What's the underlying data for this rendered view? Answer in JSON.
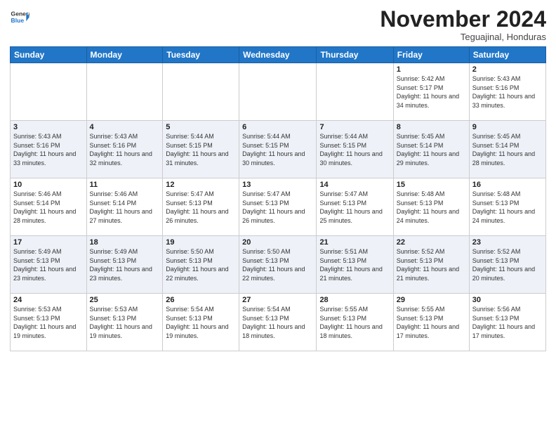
{
  "logo": {
    "line1": "General",
    "line2": "Blue"
  },
  "title": "November 2024",
  "subtitle": "Teguajinal, Honduras",
  "weekdays": [
    "Sunday",
    "Monday",
    "Tuesday",
    "Wednesday",
    "Thursday",
    "Friday",
    "Saturday"
  ],
  "weeks": [
    [
      {
        "num": "",
        "empty": true
      },
      {
        "num": "",
        "empty": true
      },
      {
        "num": "",
        "empty": true
      },
      {
        "num": "",
        "empty": true
      },
      {
        "num": "",
        "empty": true
      },
      {
        "num": "1",
        "sunrise": "5:42 AM",
        "sunset": "5:17 PM",
        "daylight": "11 hours and 34 minutes."
      },
      {
        "num": "2",
        "sunrise": "5:43 AM",
        "sunset": "5:16 PM",
        "daylight": "11 hours and 33 minutes."
      }
    ],
    [
      {
        "num": "3",
        "sunrise": "5:43 AM",
        "sunset": "5:16 PM",
        "daylight": "11 hours and 33 minutes."
      },
      {
        "num": "4",
        "sunrise": "5:43 AM",
        "sunset": "5:16 PM",
        "daylight": "11 hours and 32 minutes."
      },
      {
        "num": "5",
        "sunrise": "5:44 AM",
        "sunset": "5:15 PM",
        "daylight": "11 hours and 31 minutes."
      },
      {
        "num": "6",
        "sunrise": "5:44 AM",
        "sunset": "5:15 PM",
        "daylight": "11 hours and 30 minutes."
      },
      {
        "num": "7",
        "sunrise": "5:44 AM",
        "sunset": "5:15 PM",
        "daylight": "11 hours and 30 minutes."
      },
      {
        "num": "8",
        "sunrise": "5:45 AM",
        "sunset": "5:14 PM",
        "daylight": "11 hours and 29 minutes."
      },
      {
        "num": "9",
        "sunrise": "5:45 AM",
        "sunset": "5:14 PM",
        "daylight": "11 hours and 28 minutes."
      }
    ],
    [
      {
        "num": "10",
        "sunrise": "5:46 AM",
        "sunset": "5:14 PM",
        "daylight": "11 hours and 28 minutes."
      },
      {
        "num": "11",
        "sunrise": "5:46 AM",
        "sunset": "5:14 PM",
        "daylight": "11 hours and 27 minutes."
      },
      {
        "num": "12",
        "sunrise": "5:47 AM",
        "sunset": "5:13 PM",
        "daylight": "11 hours and 26 minutes."
      },
      {
        "num": "13",
        "sunrise": "5:47 AM",
        "sunset": "5:13 PM",
        "daylight": "11 hours and 26 minutes."
      },
      {
        "num": "14",
        "sunrise": "5:47 AM",
        "sunset": "5:13 PM",
        "daylight": "11 hours and 25 minutes."
      },
      {
        "num": "15",
        "sunrise": "5:48 AM",
        "sunset": "5:13 PM",
        "daylight": "11 hours and 24 minutes."
      },
      {
        "num": "16",
        "sunrise": "5:48 AM",
        "sunset": "5:13 PM",
        "daylight": "11 hours and 24 minutes."
      }
    ],
    [
      {
        "num": "17",
        "sunrise": "5:49 AM",
        "sunset": "5:13 PM",
        "daylight": "11 hours and 23 minutes."
      },
      {
        "num": "18",
        "sunrise": "5:49 AM",
        "sunset": "5:13 PM",
        "daylight": "11 hours and 23 minutes."
      },
      {
        "num": "19",
        "sunrise": "5:50 AM",
        "sunset": "5:13 PM",
        "daylight": "11 hours and 22 minutes."
      },
      {
        "num": "20",
        "sunrise": "5:50 AM",
        "sunset": "5:13 PM",
        "daylight": "11 hours and 22 minutes."
      },
      {
        "num": "21",
        "sunrise": "5:51 AM",
        "sunset": "5:13 PM",
        "daylight": "11 hours and 21 minutes."
      },
      {
        "num": "22",
        "sunrise": "5:52 AM",
        "sunset": "5:13 PM",
        "daylight": "11 hours and 21 minutes."
      },
      {
        "num": "23",
        "sunrise": "5:52 AM",
        "sunset": "5:13 PM",
        "daylight": "11 hours and 20 minutes."
      }
    ],
    [
      {
        "num": "24",
        "sunrise": "5:53 AM",
        "sunset": "5:13 PM",
        "daylight": "11 hours and 19 minutes."
      },
      {
        "num": "25",
        "sunrise": "5:53 AM",
        "sunset": "5:13 PM",
        "daylight": "11 hours and 19 minutes."
      },
      {
        "num": "26",
        "sunrise": "5:54 AM",
        "sunset": "5:13 PM",
        "daylight": "11 hours and 19 minutes."
      },
      {
        "num": "27",
        "sunrise": "5:54 AM",
        "sunset": "5:13 PM",
        "daylight": "11 hours and 18 minutes."
      },
      {
        "num": "28",
        "sunrise": "5:55 AM",
        "sunset": "5:13 PM",
        "daylight": "11 hours and 18 minutes."
      },
      {
        "num": "29",
        "sunrise": "5:55 AM",
        "sunset": "5:13 PM",
        "daylight": "11 hours and 17 minutes."
      },
      {
        "num": "30",
        "sunrise": "5:56 AM",
        "sunset": "5:13 PM",
        "daylight": "11 hours and 17 minutes."
      }
    ]
  ]
}
